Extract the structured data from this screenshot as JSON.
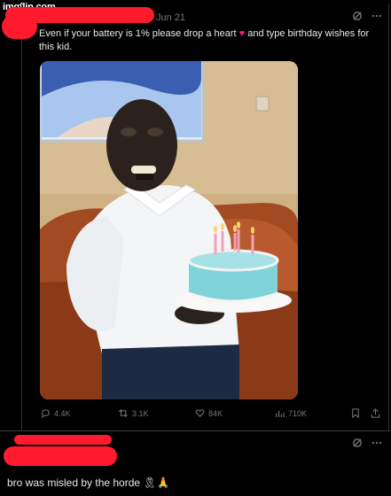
{
  "watermark": "imgflip.com",
  "post": {
    "date": "Jun 21",
    "text_before_heart": "Even if your battery is 1% please drop a heart",
    "heart_emoji": "♥",
    "text_after_heart": " and type birthday wishes for this kid.",
    "stats": {
      "replies": "4.4K",
      "reposts": "3.1K",
      "likes": "84K",
      "views": "710K"
    }
  },
  "reply": {
    "text": "bro was misled by the horde",
    "emojis": "🎗🙏"
  },
  "icons": {
    "grok": "slash-circle-icon",
    "more": "more-icon",
    "reply": "reply-icon",
    "repost": "repost-icon",
    "like": "heart-icon",
    "views": "views-icon",
    "bookmark": "bookmark-icon",
    "share": "share-icon"
  },
  "colors": {
    "background": "#000000",
    "text": "#e7e9ea",
    "muted": "#71767b",
    "redaction": "#ff1a2d",
    "heart": "#f91880"
  }
}
